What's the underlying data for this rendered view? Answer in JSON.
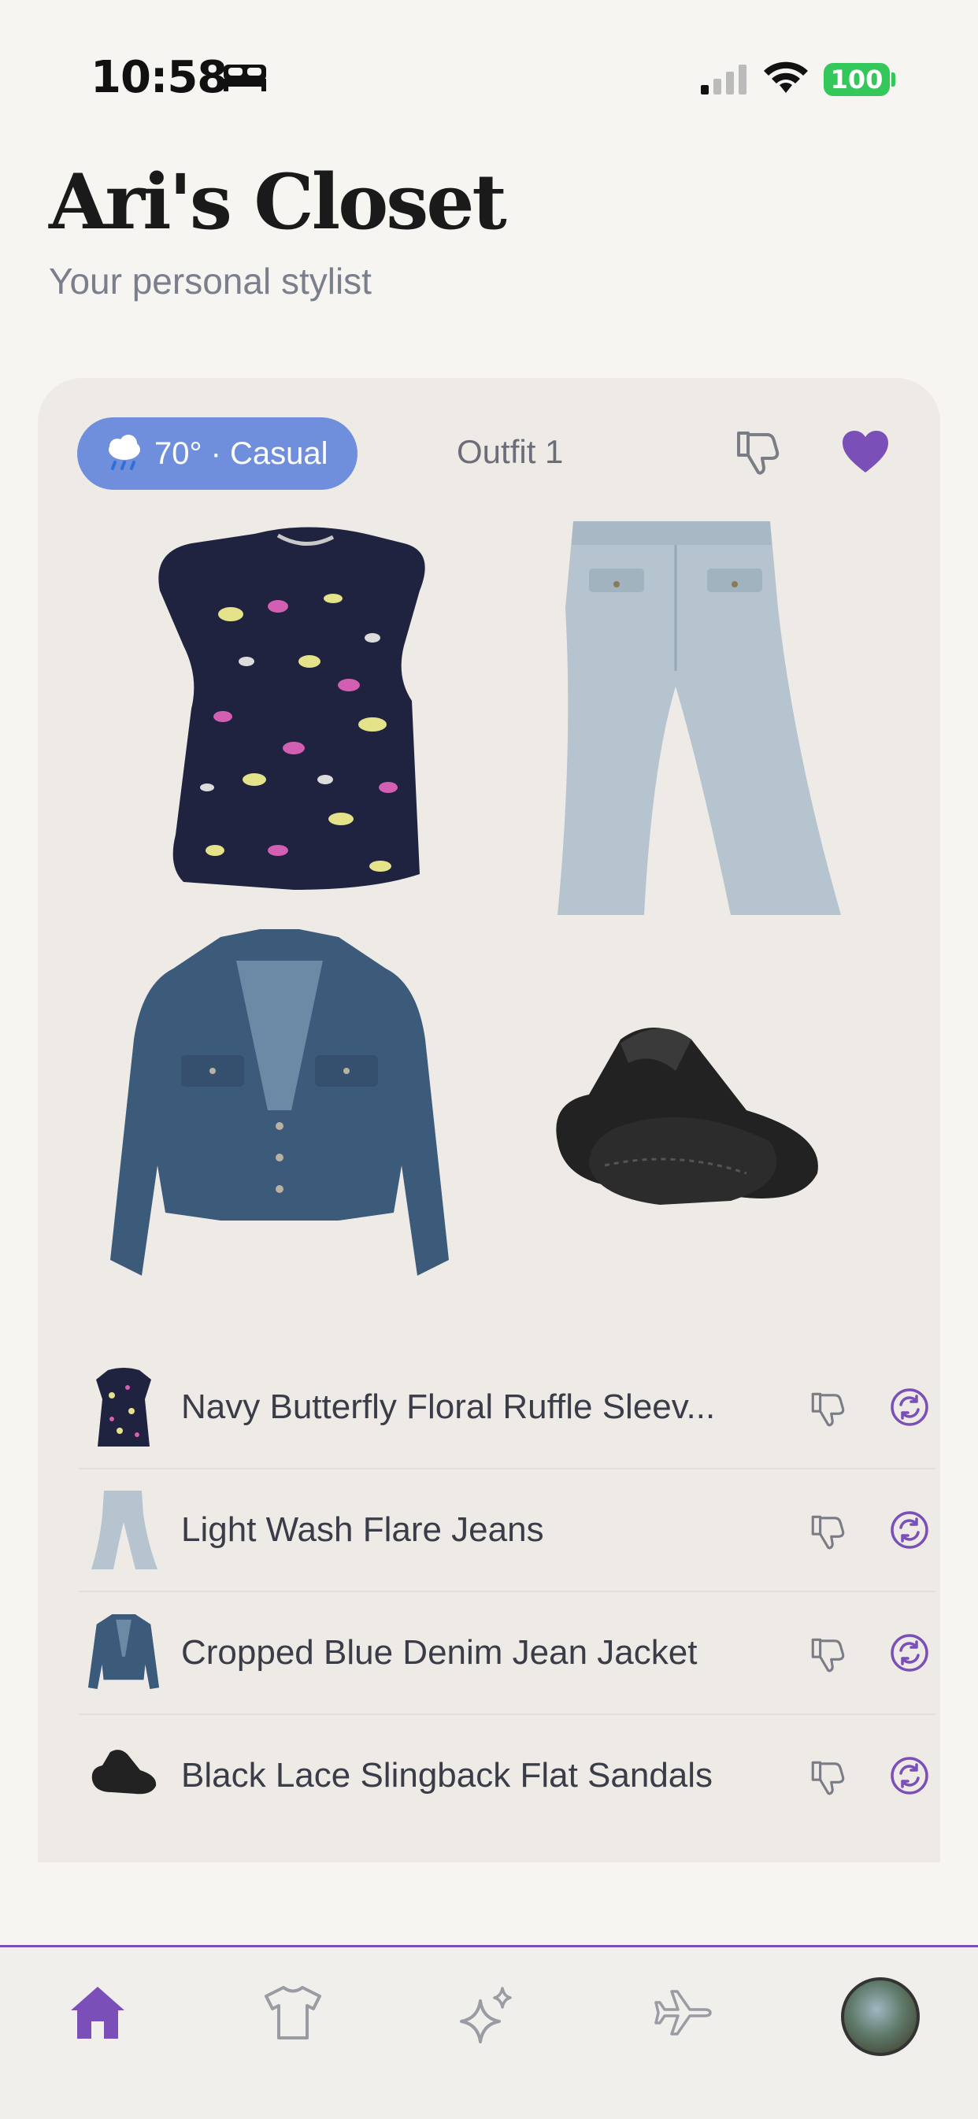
{
  "status_bar": {
    "time": "10:58",
    "battery": "100"
  },
  "header": {
    "title": "Ari's Closet",
    "subtitle": "Your personal stylist"
  },
  "outfit_card": {
    "weather_label": "70° · Casual",
    "outfit_label": "Outfit 1",
    "items": [
      {
        "name": "Navy Butterfly Floral Ruffle Sleev..."
      },
      {
        "name": "Light Wash Flare Jeans"
      },
      {
        "name": "Cropped Blue Denim Jean Jacket"
      },
      {
        "name": "Black Lace Slingback Flat Sandals"
      }
    ]
  },
  "nav": {
    "items": [
      "home-icon",
      "tshirt-icon",
      "sparkles-icon",
      "airplane-icon",
      "profile-avatar"
    ],
    "active": "home-icon"
  },
  "colors": {
    "accent": "#7b4fb8",
    "weather_pill": "#6f8fdc",
    "battery": "#34c759"
  }
}
